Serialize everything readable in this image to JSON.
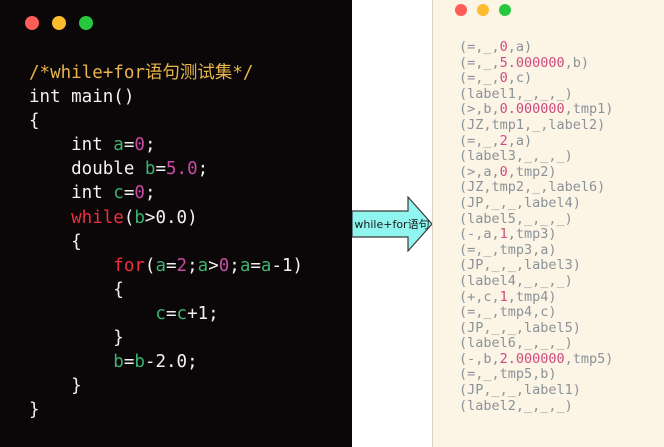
{
  "colors": {
    "editor_bg": "#0b0708",
    "output_bg": "#fcf5e6",
    "dot_red": "#fd5d56",
    "dot_yellow": "#fdbc2e",
    "dot_green": "#27c840",
    "arrow_fill": "#8ff5ee"
  },
  "editor": {
    "code_lines": [
      [
        {
          "t": "/*while+for语句测试集*/",
          "c": "comment"
        }
      ],
      [
        {
          "t": "int main()",
          "c": "plain"
        }
      ],
      [
        {
          "t": "{",
          "c": "plain"
        }
      ],
      [
        {
          "t": "    int ",
          "c": "plain"
        },
        {
          "t": "a",
          "c": "id"
        },
        {
          "t": "=",
          "c": "plain"
        },
        {
          "t": "0",
          "c": "num"
        },
        {
          "t": ";",
          "c": "plain"
        }
      ],
      [
        {
          "t": "    double ",
          "c": "plain"
        },
        {
          "t": "b",
          "c": "id"
        },
        {
          "t": "=",
          "c": "plain"
        },
        {
          "t": "5.0",
          "c": "num"
        },
        {
          "t": ";",
          "c": "plain"
        }
      ],
      [
        {
          "t": "    int ",
          "c": "plain"
        },
        {
          "t": "c",
          "c": "id"
        },
        {
          "t": "=",
          "c": "plain"
        },
        {
          "t": "0",
          "c": "num"
        },
        {
          "t": ";",
          "c": "plain"
        }
      ],
      [
        {
          "t": "    while",
          "c": "kw"
        },
        {
          "t": "(",
          "c": "plain"
        },
        {
          "t": "b",
          "c": "id"
        },
        {
          "t": ">0.0)",
          "c": "plain"
        }
      ],
      [
        {
          "t": "    {",
          "c": "plain"
        }
      ],
      [
        {
          "t": "        for",
          "c": "kw"
        },
        {
          "t": "(",
          "c": "plain"
        },
        {
          "t": "a",
          "c": "id"
        },
        {
          "t": "=",
          "c": "plain"
        },
        {
          "t": "2",
          "c": "num"
        },
        {
          "t": ";",
          "c": "plain"
        },
        {
          "t": "a",
          "c": "id"
        },
        {
          "t": ">",
          "c": "plain"
        },
        {
          "t": "0",
          "c": "num"
        },
        {
          "t": ";",
          "c": "plain"
        },
        {
          "t": "a",
          "c": "id"
        },
        {
          "t": "=",
          "c": "plain"
        },
        {
          "t": "a",
          "c": "id"
        },
        {
          "t": "-1)",
          "c": "plain"
        }
      ],
      [
        {
          "t": "        {",
          "c": "plain"
        }
      ],
      [
        {
          "t": "            c",
          "c": "id"
        },
        {
          "t": "=",
          "c": "plain"
        },
        {
          "t": "c",
          "c": "id"
        },
        {
          "t": "+1;",
          "c": "plain"
        }
      ],
      [
        {
          "t": "        }",
          "c": "plain"
        }
      ],
      [
        {
          "t": "        b",
          "c": "id"
        },
        {
          "t": "=",
          "c": "plain"
        },
        {
          "t": "b",
          "c": "id"
        },
        {
          "t": "-2.0;",
          "c": "plain"
        }
      ],
      [
        {
          "t": "    }",
          "c": "plain"
        }
      ],
      [
        {
          "t": "}",
          "c": "plain"
        }
      ]
    ]
  },
  "arrow": {
    "label": "while+for语句"
  },
  "output": {
    "quadruples": [
      [
        {
          "t": "(=,_,",
          "c": "p"
        },
        {
          "t": "0",
          "c": "num"
        },
        {
          "t": ",a)",
          "c": "p"
        }
      ],
      [
        {
          "t": "(=,_,",
          "c": "p"
        },
        {
          "t": "5.000000",
          "c": "num"
        },
        {
          "t": ",b)",
          "c": "p"
        }
      ],
      [
        {
          "t": "(=,_,",
          "c": "p"
        },
        {
          "t": "0",
          "c": "num"
        },
        {
          "t": ",c)",
          "c": "p"
        }
      ],
      [
        {
          "t": "(label1,_,_,_)",
          "c": "p"
        }
      ],
      [
        {
          "t": "(>,b,",
          "c": "p"
        },
        {
          "t": "0.000000",
          "c": "num"
        },
        {
          "t": ",tmp1)",
          "c": "p"
        }
      ],
      [
        {
          "t": "(JZ,tmp1,_,label2)",
          "c": "p"
        }
      ],
      [
        {
          "t": "(=,_,",
          "c": "p"
        },
        {
          "t": "2",
          "c": "num"
        },
        {
          "t": ",a)",
          "c": "p"
        }
      ],
      [
        {
          "t": "(label3,_,_,_)",
          "c": "p"
        }
      ],
      [
        {
          "t": "(>,a,",
          "c": "p"
        },
        {
          "t": "0",
          "c": "num"
        },
        {
          "t": ",tmp2)",
          "c": "p"
        }
      ],
      [
        {
          "t": "(JZ,tmp2,_,label6)",
          "c": "p"
        }
      ],
      [
        {
          "t": "(JP,_,_,label4)",
          "c": "p"
        }
      ],
      [
        {
          "t": "(label5,_,_,_)",
          "c": "p"
        }
      ],
      [
        {
          "t": "(-,a,",
          "c": "p"
        },
        {
          "t": "1",
          "c": "num"
        },
        {
          "t": ",tmp3)",
          "c": "p"
        }
      ],
      [
        {
          "t": "(=,_,tmp3,a)",
          "c": "p"
        }
      ],
      [
        {
          "t": "(JP,_,_,label3)",
          "c": "p"
        }
      ],
      [
        {
          "t": "(label4,_,_,_)",
          "c": "p"
        }
      ],
      [
        {
          "t": "(+,c,",
          "c": "p"
        },
        {
          "t": "1",
          "c": "num"
        },
        {
          "t": ",tmp4)",
          "c": "p"
        }
      ],
      [
        {
          "t": "(=,_,tmp4,c)",
          "c": "p"
        }
      ],
      [
        {
          "t": "(JP,_,_,label5)",
          "c": "p"
        }
      ],
      [
        {
          "t": "(label6,_,_,_)",
          "c": "p"
        }
      ],
      [
        {
          "t": "(-,b,",
          "c": "p"
        },
        {
          "t": "2.000000",
          "c": "num"
        },
        {
          "t": ",tmp5)",
          "c": "p"
        }
      ],
      [
        {
          "t": "(=,_,tmp5,b)",
          "c": "p"
        }
      ],
      [
        {
          "t": "(JP,_,_,label1)",
          "c": "p"
        }
      ],
      [
        {
          "t": "(label2,_,_,_)",
          "c": "p"
        }
      ]
    ]
  }
}
